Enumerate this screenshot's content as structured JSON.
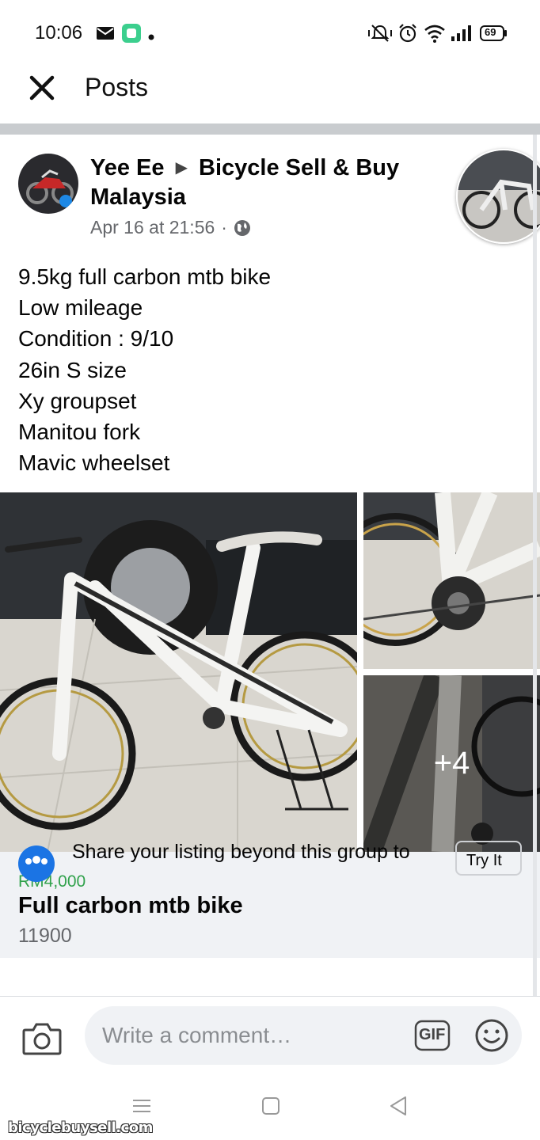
{
  "status_bar": {
    "time": "10:06",
    "left_icons": [
      "mail-icon",
      "app-notification-icon",
      "dot-icon"
    ],
    "right_icons": [
      "vibrate-mute-icon",
      "alarm-icon",
      "wifi-icon",
      "signal-icon",
      "battery-icon"
    ],
    "battery_level": "69"
  },
  "header": {
    "close_icon": "close-icon",
    "title": "Posts"
  },
  "post": {
    "author": "Yee Ee",
    "group": "Bicycle Sell & Buy Malaysia",
    "timestamp": "Apr 16 at 21:56",
    "separator": "·",
    "privacy_icon": "globe-icon",
    "body_lines": [
      "9.5kg full carbon mtb bike",
      "Low mileage",
      "Condition : 9/10",
      "26in S size",
      "Xy groupset",
      "Manitou fork",
      "Mavic wheelset"
    ],
    "more_photos": "+4"
  },
  "listing": {
    "price": "RM4,000",
    "title": "Full carbon mtb bike",
    "subtitle": "11900"
  },
  "share_prompt": {
    "text": "Share your listing beyond this group to",
    "button": "Try It"
  },
  "comment_bar": {
    "placeholder": "Write a comment…",
    "camera_icon": "camera-icon",
    "gif_label": "GIF",
    "emoji_icon": "emoji-icon"
  },
  "nav_bar": {
    "icons": [
      "recent-apps-icon",
      "home-icon",
      "back-icon"
    ]
  },
  "watermark": "bicyclebuysell.com",
  "colors": {
    "price_green": "#31a24c",
    "meta_gray": "#65676b",
    "input_bg": "#f0f2f5",
    "accent_blue": "#1b74e4"
  }
}
